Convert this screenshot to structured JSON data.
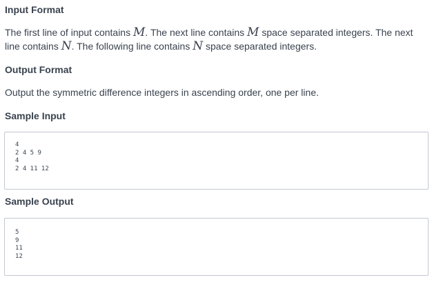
{
  "input_format": {
    "heading": "Input Format",
    "parts": [
      "The first line of input contains ",
      "M",
      ". The next line contains ",
      "M",
      " space separated integers. The next line contains ",
      "N",
      ". The following line contains ",
      "N",
      " space separated integers."
    ]
  },
  "output_format": {
    "heading": "Output Format",
    "text": "Output the symmetric difference integers in ascending order, one per line."
  },
  "sample_input": {
    "heading": "Sample Input",
    "lines": [
      "4",
      "2 4 5 9",
      "4",
      "2 4 11 12"
    ]
  },
  "sample_output": {
    "heading": "Sample Output",
    "lines": [
      "5",
      "9",
      "11",
      "12"
    ]
  }
}
